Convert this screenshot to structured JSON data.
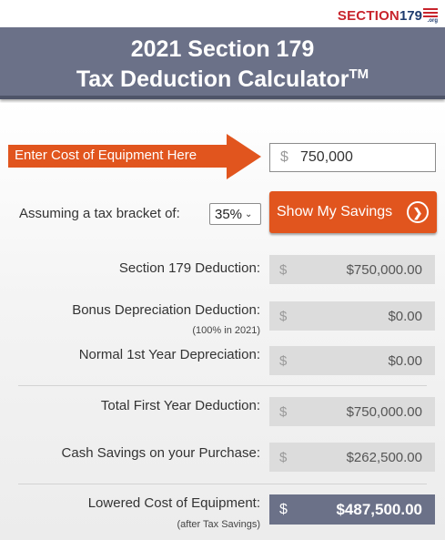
{
  "logo": {
    "word": "SECTION",
    "number": "179",
    "suffix": ".org"
  },
  "header": {
    "title_line1": "2021 Section 179",
    "title_line2": "Tax Deduction Calculator",
    "trademark": "TM"
  },
  "entry": {
    "arrow_label": "Enter Cost of Equipment Here",
    "currency_symbol": "$",
    "cost_value": "750,000"
  },
  "tax_bracket": {
    "label": "Assuming a tax bracket of:",
    "selected": "35%"
  },
  "show_savings_button": {
    "label": "Show My Savings"
  },
  "results": {
    "section179": {
      "label": "Section 179 Deduction:",
      "currency": "$",
      "value": "$750,000.00"
    },
    "bonus": {
      "label": "Bonus Depreciation Deduction:",
      "sublabel": "(100% in 2021)",
      "currency": "$",
      "value": "$0.00"
    },
    "normal": {
      "label": "Normal 1st Year Depreciation:",
      "currency": "$",
      "value": "$0.00"
    },
    "total": {
      "label": "Total First Year Deduction:",
      "currency": "$",
      "value": "$750,000.00"
    },
    "cash_savings": {
      "label": "Cash Savings on your Purchase:",
      "currency": "$",
      "value": "$262,500.00"
    },
    "lowered_cost": {
      "label": "Lowered Cost of Equipment:",
      "sublabel": "(after Tax Savings)",
      "currency": "$",
      "value": "$487,500.00"
    }
  },
  "colors": {
    "header_bg": "#6b7188",
    "accent_orange": "#e1551e",
    "output_bg": "#dcdcdc",
    "logo_red": "#c8242c",
    "logo_blue": "#1e3b6e"
  },
  "icons": [
    "flag-icon",
    "arrow-right-circle-icon",
    "chevron-down-icon"
  ]
}
